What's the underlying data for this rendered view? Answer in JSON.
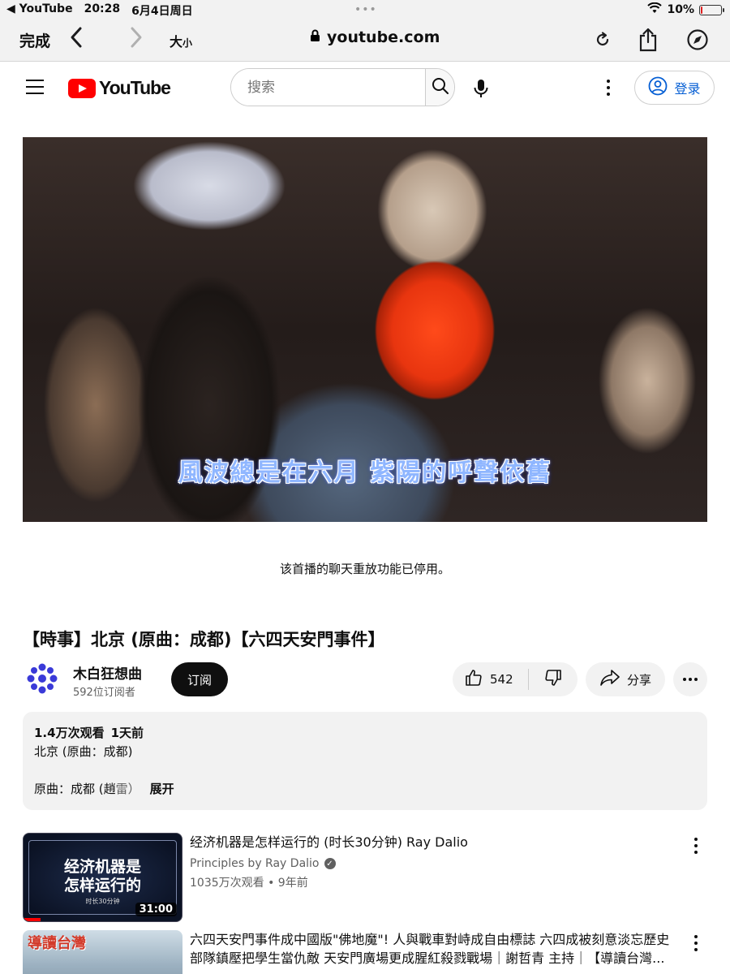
{
  "status_bar": {
    "back_app": "◀ YouTube",
    "time": "20:28",
    "date": "6月4日周日",
    "battery": "10%",
    "battery_level": 0.1
  },
  "safari": {
    "done": "完成",
    "text_size": "大",
    "text_size_small": "小",
    "url": "youtube.com"
  },
  "header": {
    "logo_text": "YouTube",
    "search_placeholder": "搜索",
    "login": "登录"
  },
  "video": {
    "subtitle": "風波總是在六月 紫陽的呼聲依舊"
  },
  "chat_note": "该首播的聊天重放功能已停用。",
  "title": "【時事】北京 (原曲：成都)【六四天安門事件】",
  "channel": {
    "name": "木白狂想曲",
    "subscribers": "592位订阅者",
    "subscribe": "订阅"
  },
  "actions": {
    "likes": "542",
    "share": "分享"
  },
  "description": {
    "views": "1.4万次观看",
    "age": "1天前",
    "line1": "北京 (原曲：成都)",
    "line2_prefix": "原曲：成都 (趙",
    "line2_faded": "雷）",
    "more": "展开"
  },
  "recommendations": [
    {
      "title": "经济机器是怎样运行的 (时长30分钟) Ray Dalio",
      "channel": "Principles by Ray Dalio",
      "meta": "1035万次观看 • 9年前",
      "duration": "31:00",
      "thumb_line1": "经济机器是",
      "thumb_line2": "怎样运行的",
      "thumb_line3": "时长30分钟",
      "progress": 0.11
    },
    {
      "title": "六四天安門事件成中國版\"佛地魔\"! 人與戰車對峙成自由標誌 六四成被刻意淡忘歷史 部隊鎮壓把學生當仇敵 天安門廣場更成腥紅殺戮戰場｜謝哲青 主持｜【導讀台灣...",
      "thumb_brand": "導讀台灣"
    }
  ],
  "colors": {
    "accent_red": "#ff0000",
    "link_blue": "#065fd4"
  }
}
